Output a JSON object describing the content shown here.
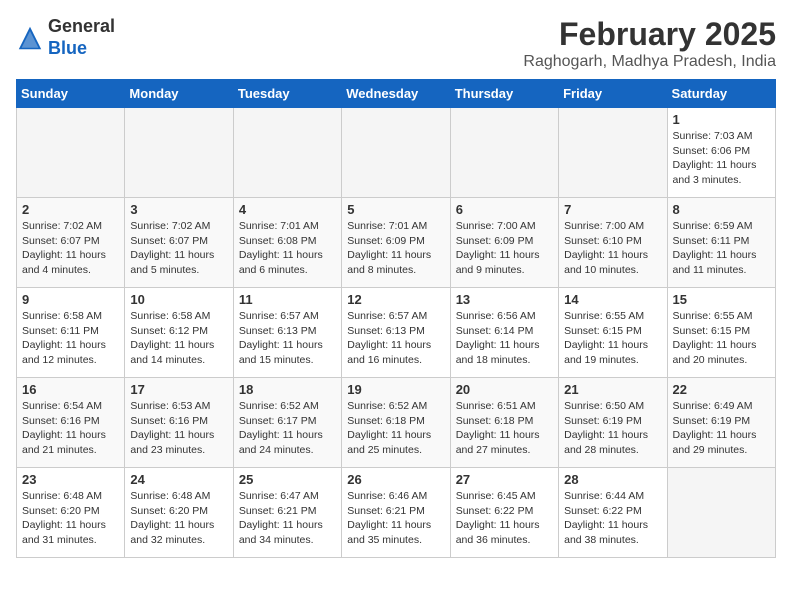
{
  "header": {
    "logo_general": "General",
    "logo_blue": "Blue",
    "title": "February 2025",
    "subtitle": "Raghogarh, Madhya Pradesh, India"
  },
  "days_of_week": [
    "Sunday",
    "Monday",
    "Tuesday",
    "Wednesday",
    "Thursday",
    "Friday",
    "Saturday"
  ],
  "weeks": [
    [
      {
        "day": "",
        "info": ""
      },
      {
        "day": "",
        "info": ""
      },
      {
        "day": "",
        "info": ""
      },
      {
        "day": "",
        "info": ""
      },
      {
        "day": "",
        "info": ""
      },
      {
        "day": "",
        "info": ""
      },
      {
        "day": "1",
        "info": "Sunrise: 7:03 AM\nSunset: 6:06 PM\nDaylight: 11 hours\nand 3 minutes."
      }
    ],
    [
      {
        "day": "2",
        "info": "Sunrise: 7:02 AM\nSunset: 6:07 PM\nDaylight: 11 hours\nand 4 minutes."
      },
      {
        "day": "3",
        "info": "Sunrise: 7:02 AM\nSunset: 6:07 PM\nDaylight: 11 hours\nand 5 minutes."
      },
      {
        "day": "4",
        "info": "Sunrise: 7:01 AM\nSunset: 6:08 PM\nDaylight: 11 hours\nand 6 minutes."
      },
      {
        "day": "5",
        "info": "Sunrise: 7:01 AM\nSunset: 6:09 PM\nDaylight: 11 hours\nand 8 minutes."
      },
      {
        "day": "6",
        "info": "Sunrise: 7:00 AM\nSunset: 6:09 PM\nDaylight: 11 hours\nand 9 minutes."
      },
      {
        "day": "7",
        "info": "Sunrise: 7:00 AM\nSunset: 6:10 PM\nDaylight: 11 hours\nand 10 minutes."
      },
      {
        "day": "8",
        "info": "Sunrise: 6:59 AM\nSunset: 6:11 PM\nDaylight: 11 hours\nand 11 minutes."
      }
    ],
    [
      {
        "day": "9",
        "info": "Sunrise: 6:58 AM\nSunset: 6:11 PM\nDaylight: 11 hours\nand 12 minutes."
      },
      {
        "day": "10",
        "info": "Sunrise: 6:58 AM\nSunset: 6:12 PM\nDaylight: 11 hours\nand 14 minutes."
      },
      {
        "day": "11",
        "info": "Sunrise: 6:57 AM\nSunset: 6:13 PM\nDaylight: 11 hours\nand 15 minutes."
      },
      {
        "day": "12",
        "info": "Sunrise: 6:57 AM\nSunset: 6:13 PM\nDaylight: 11 hours\nand 16 minutes."
      },
      {
        "day": "13",
        "info": "Sunrise: 6:56 AM\nSunset: 6:14 PM\nDaylight: 11 hours\nand 18 minutes."
      },
      {
        "day": "14",
        "info": "Sunrise: 6:55 AM\nSunset: 6:15 PM\nDaylight: 11 hours\nand 19 minutes."
      },
      {
        "day": "15",
        "info": "Sunrise: 6:55 AM\nSunset: 6:15 PM\nDaylight: 11 hours\nand 20 minutes."
      }
    ],
    [
      {
        "day": "16",
        "info": "Sunrise: 6:54 AM\nSunset: 6:16 PM\nDaylight: 11 hours\nand 21 minutes."
      },
      {
        "day": "17",
        "info": "Sunrise: 6:53 AM\nSunset: 6:16 PM\nDaylight: 11 hours\nand 23 minutes."
      },
      {
        "day": "18",
        "info": "Sunrise: 6:52 AM\nSunset: 6:17 PM\nDaylight: 11 hours\nand 24 minutes."
      },
      {
        "day": "19",
        "info": "Sunrise: 6:52 AM\nSunset: 6:18 PM\nDaylight: 11 hours\nand 25 minutes."
      },
      {
        "day": "20",
        "info": "Sunrise: 6:51 AM\nSunset: 6:18 PM\nDaylight: 11 hours\nand 27 minutes."
      },
      {
        "day": "21",
        "info": "Sunrise: 6:50 AM\nSunset: 6:19 PM\nDaylight: 11 hours\nand 28 minutes."
      },
      {
        "day": "22",
        "info": "Sunrise: 6:49 AM\nSunset: 6:19 PM\nDaylight: 11 hours\nand 29 minutes."
      }
    ],
    [
      {
        "day": "23",
        "info": "Sunrise: 6:48 AM\nSunset: 6:20 PM\nDaylight: 11 hours\nand 31 minutes."
      },
      {
        "day": "24",
        "info": "Sunrise: 6:48 AM\nSunset: 6:20 PM\nDaylight: 11 hours\nand 32 minutes."
      },
      {
        "day": "25",
        "info": "Sunrise: 6:47 AM\nSunset: 6:21 PM\nDaylight: 11 hours\nand 34 minutes."
      },
      {
        "day": "26",
        "info": "Sunrise: 6:46 AM\nSunset: 6:21 PM\nDaylight: 11 hours\nand 35 minutes."
      },
      {
        "day": "27",
        "info": "Sunrise: 6:45 AM\nSunset: 6:22 PM\nDaylight: 11 hours\nand 36 minutes."
      },
      {
        "day": "28",
        "info": "Sunrise: 6:44 AM\nSunset: 6:22 PM\nDaylight: 11 hours\nand 38 minutes."
      },
      {
        "day": "",
        "info": ""
      }
    ]
  ]
}
